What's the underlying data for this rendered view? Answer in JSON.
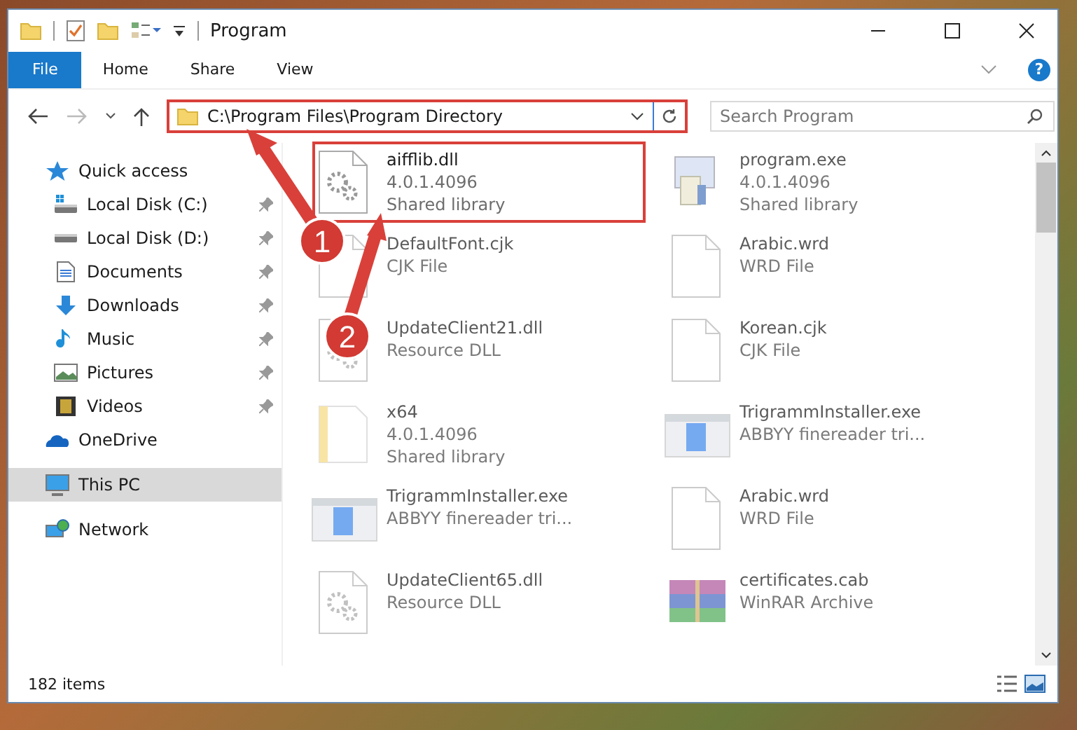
{
  "window": {
    "title": "Program"
  },
  "ribbon": {
    "tabs": [
      {
        "label": "File",
        "kind": "file"
      },
      {
        "label": "Home",
        "kind": "tab"
      },
      {
        "label": "Share",
        "kind": "tab"
      },
      {
        "label": "View",
        "kind": "tab"
      }
    ],
    "help_label": "?"
  },
  "address": {
    "path": "C:\\Program Files\\Program Directory"
  },
  "search": {
    "placeholder": "Search Program"
  },
  "sidebar": {
    "items": [
      {
        "label": "Quick access",
        "kind": "star",
        "selected": false,
        "children": [
          {
            "label": "Local Disk (C:)",
            "kind": "drive-os",
            "selected": false,
            "pinned": true
          },
          {
            "label": "Local Disk (D:)",
            "kind": "drive",
            "selected": false,
            "pinned": true
          },
          {
            "label": "Documents",
            "kind": "documents",
            "selected": false,
            "pinned": true
          },
          {
            "label": "Downloads",
            "kind": "downloads",
            "selected": false,
            "pinned": true
          },
          {
            "label": "Music",
            "kind": "music",
            "selected": false,
            "pinned": true
          },
          {
            "label": "Pictures",
            "kind": "pictures",
            "selected": false,
            "pinned": true
          },
          {
            "label": "Videos",
            "kind": "videos",
            "selected": false,
            "pinned": true
          }
        ]
      },
      {
        "label": "OneDrive",
        "kind": "cloud",
        "selected": false
      },
      {
        "label": "This PC",
        "kind": "pc",
        "selected": true
      },
      {
        "label": "Network",
        "kind": "network",
        "selected": false
      }
    ]
  },
  "files": [
    {
      "name": "aifflib.dll",
      "lines": [
        "4.0.1.4096",
        "Shared library"
      ],
      "kind": "dll",
      "blurred": false
    },
    {
      "name": "program.exe",
      "lines": [
        "4.0.1.4096",
        "Shared library"
      ],
      "kind": "program",
      "blurred": true
    },
    {
      "name": "DefaultFont.cjk",
      "lines": [
        "CJK File"
      ],
      "kind": "blank",
      "blurred": true
    },
    {
      "name": "Arabic.wrd",
      "lines": [
        "WRD File"
      ],
      "kind": "blank",
      "blurred": true
    },
    {
      "name": "UpdateClient21.dll",
      "lines": [
        "Resource DLL"
      ],
      "kind": "dll",
      "blurred": true
    },
    {
      "name": "Korean.cjk",
      "lines": [
        "CJK File"
      ],
      "kind": "blank",
      "blurred": true
    },
    {
      "name": "x64",
      "lines": [
        "4.0.1.4096",
        "Shared library"
      ],
      "kind": "folder",
      "blurred": true
    },
    {
      "name": "TrigrammInstaller.exe",
      "lines": [
        "ABBYY finereader tri..."
      ],
      "kind": "installer",
      "blurred": true
    },
    {
      "name": "TrigrammInstaller.exe",
      "lines": [
        "ABBYY finereader tri..."
      ],
      "kind": "installer",
      "blurred": true
    },
    {
      "name": "Arabic.wrd",
      "lines": [
        "WRD File"
      ],
      "kind": "blank",
      "blurred": true
    },
    {
      "name": "UpdateClient65.dll",
      "lines": [
        "Resource DLL"
      ],
      "kind": "dll",
      "blurred": true
    },
    {
      "name": "certificates.cab",
      "lines": [
        "WinRAR Archive"
      ],
      "kind": "archive",
      "blurred": true
    }
  ],
  "status_bar": {
    "count": "182 items"
  },
  "annotations": [
    {
      "number": "1"
    },
    {
      "number": "2"
    }
  ]
}
